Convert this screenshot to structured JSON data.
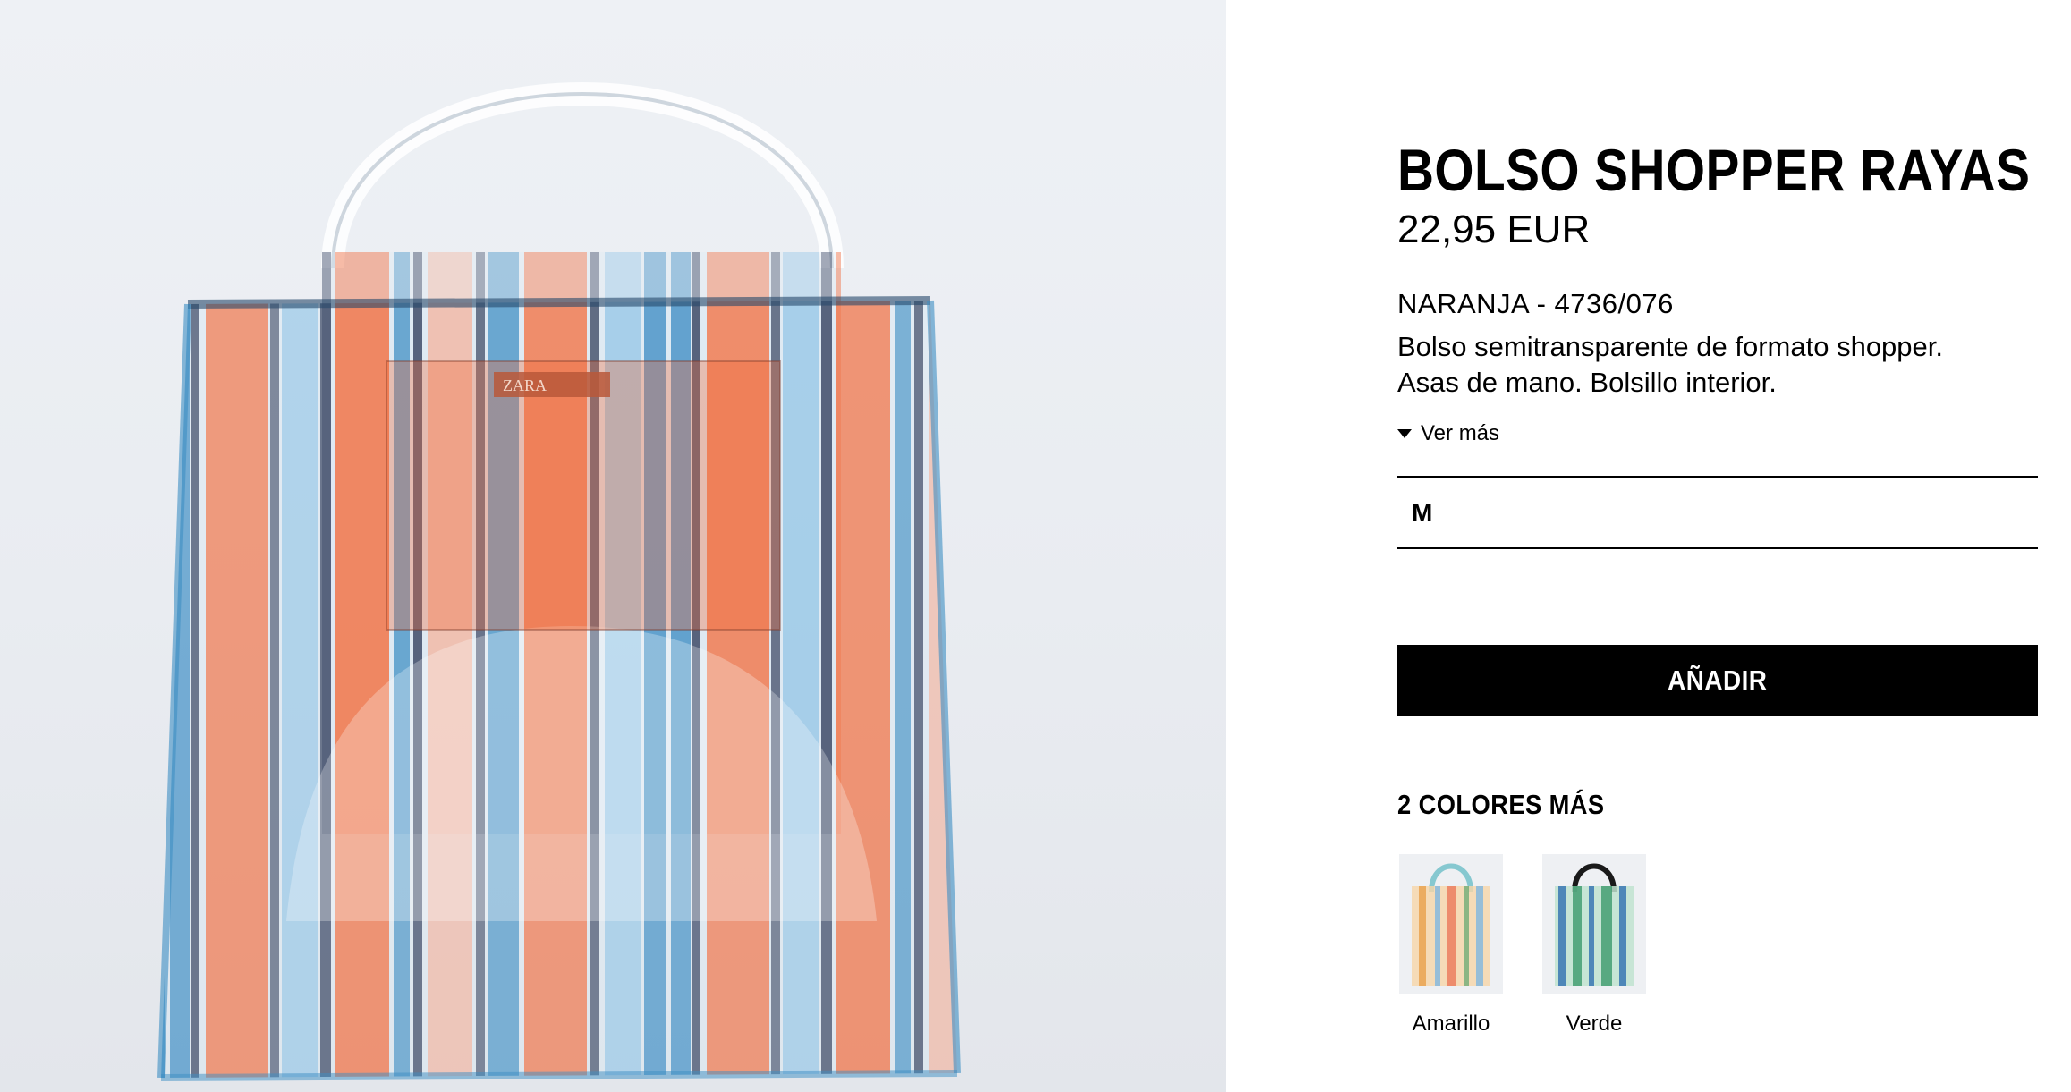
{
  "product": {
    "title": "BOLSO SHOPPER RAYAS",
    "price": "22,95 EUR",
    "color_ref": "NARANJA - 4736/076",
    "description_line1": "Bolso semitransparente de formato shopper.",
    "description_line2": "Asas de mano. Bolsillo interior.",
    "ver_mas": "Ver más",
    "size": "M",
    "add_button": "AÑADIR",
    "brand_label": "ZARA"
  },
  "colors": {
    "heading": "2 COLORES MÁS",
    "options": [
      {
        "label": "Amarillo",
        "accent": "#e8a04a",
        "handle": "#86c8d0"
      },
      {
        "label": "Verde",
        "accent": "#3c9a6c",
        "handle": "#1a1a1a"
      }
    ]
  },
  "image": {
    "stripe_orange": "#f26b3a",
    "stripe_blue": "#3e8fc4",
    "stripe_navy": "#1c2a4a",
    "background": "#eceff3"
  }
}
